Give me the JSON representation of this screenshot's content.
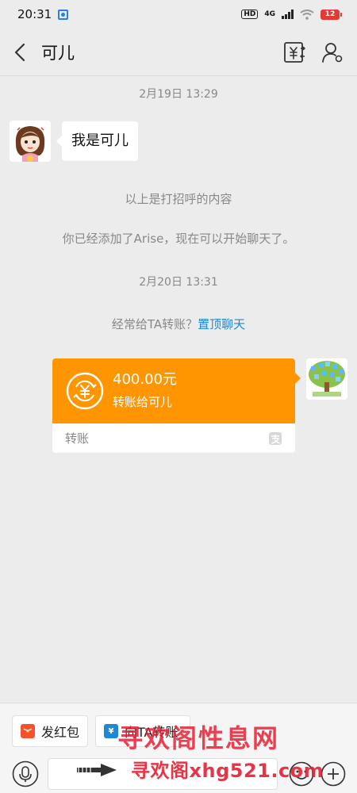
{
  "status_bar": {
    "time": "20:31",
    "hd": "HD",
    "network": "4G",
    "battery": "12",
    "battery_color": "#e53935"
  },
  "header": {
    "back_icon": "chevron-left-icon",
    "title": "可儿",
    "transfer_icon": "yen-transfer-icon",
    "profile_icon": "contact-settings-icon"
  },
  "chat": {
    "timestamp_1": "2月19日 13:29",
    "greeting_message": "我是可儿",
    "system_greeting": "以上是打招呼的内容",
    "system_added": "你已经添加了Arise，现在可以开始聊天了。",
    "timestamp_2": "2月20日 13:31",
    "pin_prompt": "经常给TA转账？",
    "pin_link": "置顶聊天",
    "transfer": {
      "amount": "400.00元",
      "description": "转账给可儿",
      "footer_label": "转账",
      "card_color": "#ff9500"
    }
  },
  "bottom": {
    "quick_redpacket": "发红包",
    "quick_transfer": "向TA转账",
    "input_value": "",
    "voice_icon": "microphone-icon",
    "emoji_icon": "smiley-icon",
    "add_icon": "plus-icon"
  },
  "watermark": {
    "line1": "寻欢阁性息网",
    "line2": "寻欢阁xhg521.com"
  },
  "accent_link_color": "#1e88d8"
}
